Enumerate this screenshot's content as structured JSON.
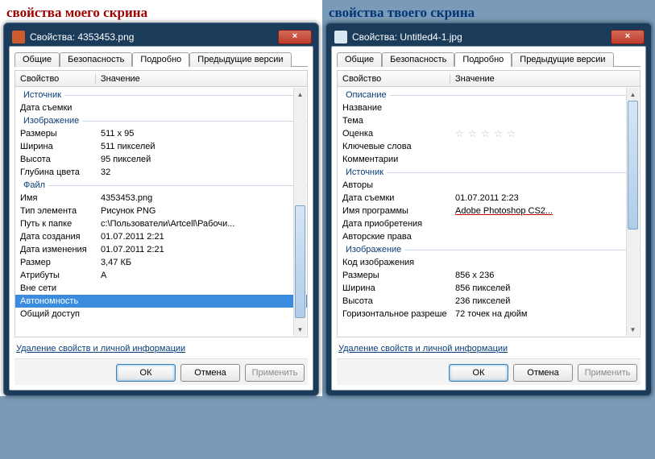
{
  "left": {
    "caption": "свойства моего скрина",
    "title": "Свойства: 4353453.png",
    "tabs": [
      "Общие",
      "Безопасность",
      "Подробно",
      "Предыдущие версии"
    ],
    "activeTab": 2,
    "headers": {
      "prop": "Свойство",
      "val": "Значение"
    },
    "groups": [
      {
        "label": "Источник",
        "rows": [
          {
            "p": "Дата съемки",
            "v": ""
          }
        ]
      },
      {
        "label": "Изображение",
        "rows": [
          {
            "p": "Размеры",
            "v": "511 x 95"
          },
          {
            "p": "Ширина",
            "v": "511 пикселей"
          },
          {
            "p": "Высота",
            "v": "95 пикселей"
          },
          {
            "p": "Глубина цвета",
            "v": "32"
          }
        ]
      },
      {
        "label": "Файл",
        "rows": [
          {
            "p": "Имя",
            "v": "4353453.png"
          },
          {
            "p": "Тип элемента",
            "v": "Рисунок PNG"
          },
          {
            "p": "Путь к папке",
            "v": "c:\\Пользователи\\Artcell\\Рабочи..."
          },
          {
            "p": "Дата создания",
            "v": "01.07.2011 2:21"
          },
          {
            "p": "Дата изменения",
            "v": "01.07.2011 2:21"
          },
          {
            "p": "Размер",
            "v": "3,47 КБ"
          },
          {
            "p": "Атрибуты",
            "v": "A"
          },
          {
            "p": "Вне сети",
            "v": ""
          },
          {
            "p": "Автономность",
            "v": "",
            "selected": true
          },
          {
            "p": "Общий доступ",
            "v": ""
          }
        ]
      }
    ],
    "link": "Удаление свойств и личной информации",
    "buttons": {
      "ok": "ОК",
      "cancel": "Отмена",
      "apply": "Применить"
    }
  },
  "right": {
    "caption": "свойства твоего скрина",
    "title": "Свойства: Untitled4-1.jpg",
    "tabs": [
      "Общие",
      "Безопасность",
      "Подробно",
      "Предыдущие версии"
    ],
    "activeTab": 2,
    "headers": {
      "prop": "Свойство",
      "val": "Значение"
    },
    "groups": [
      {
        "label": "Описание",
        "rows": [
          {
            "p": "Название",
            "v": ""
          },
          {
            "p": "Тема",
            "v": ""
          },
          {
            "p": "Оценка",
            "v": "",
            "stars": true
          },
          {
            "p": "Ключевые слова",
            "v": ""
          },
          {
            "p": "Комментарии",
            "v": ""
          }
        ]
      },
      {
        "label": "Источник",
        "rows": [
          {
            "p": "Авторы",
            "v": ""
          },
          {
            "p": "Дата съемки",
            "v": "01.07.2011 2:23"
          },
          {
            "p": "Имя программы",
            "v": "Adobe Photoshop CS2...",
            "highlight": true
          },
          {
            "p": "Дата приобретения",
            "v": ""
          },
          {
            "p": "Авторские права",
            "v": ""
          }
        ]
      },
      {
        "label": "Изображение",
        "rows": [
          {
            "p": "Код изображения",
            "v": ""
          },
          {
            "p": "Размеры",
            "v": "856 x 236"
          },
          {
            "p": "Ширина",
            "v": "856 пикселей"
          },
          {
            "p": "Высота",
            "v": "236 пикселей"
          },
          {
            "p": "Горизонтальное разреше",
            "v": "72 точек на дюйм"
          }
        ]
      }
    ],
    "link": "Удаление свойств и личной информации",
    "buttons": {
      "ok": "ОК",
      "cancel": "Отмена",
      "apply": "Применить"
    }
  }
}
